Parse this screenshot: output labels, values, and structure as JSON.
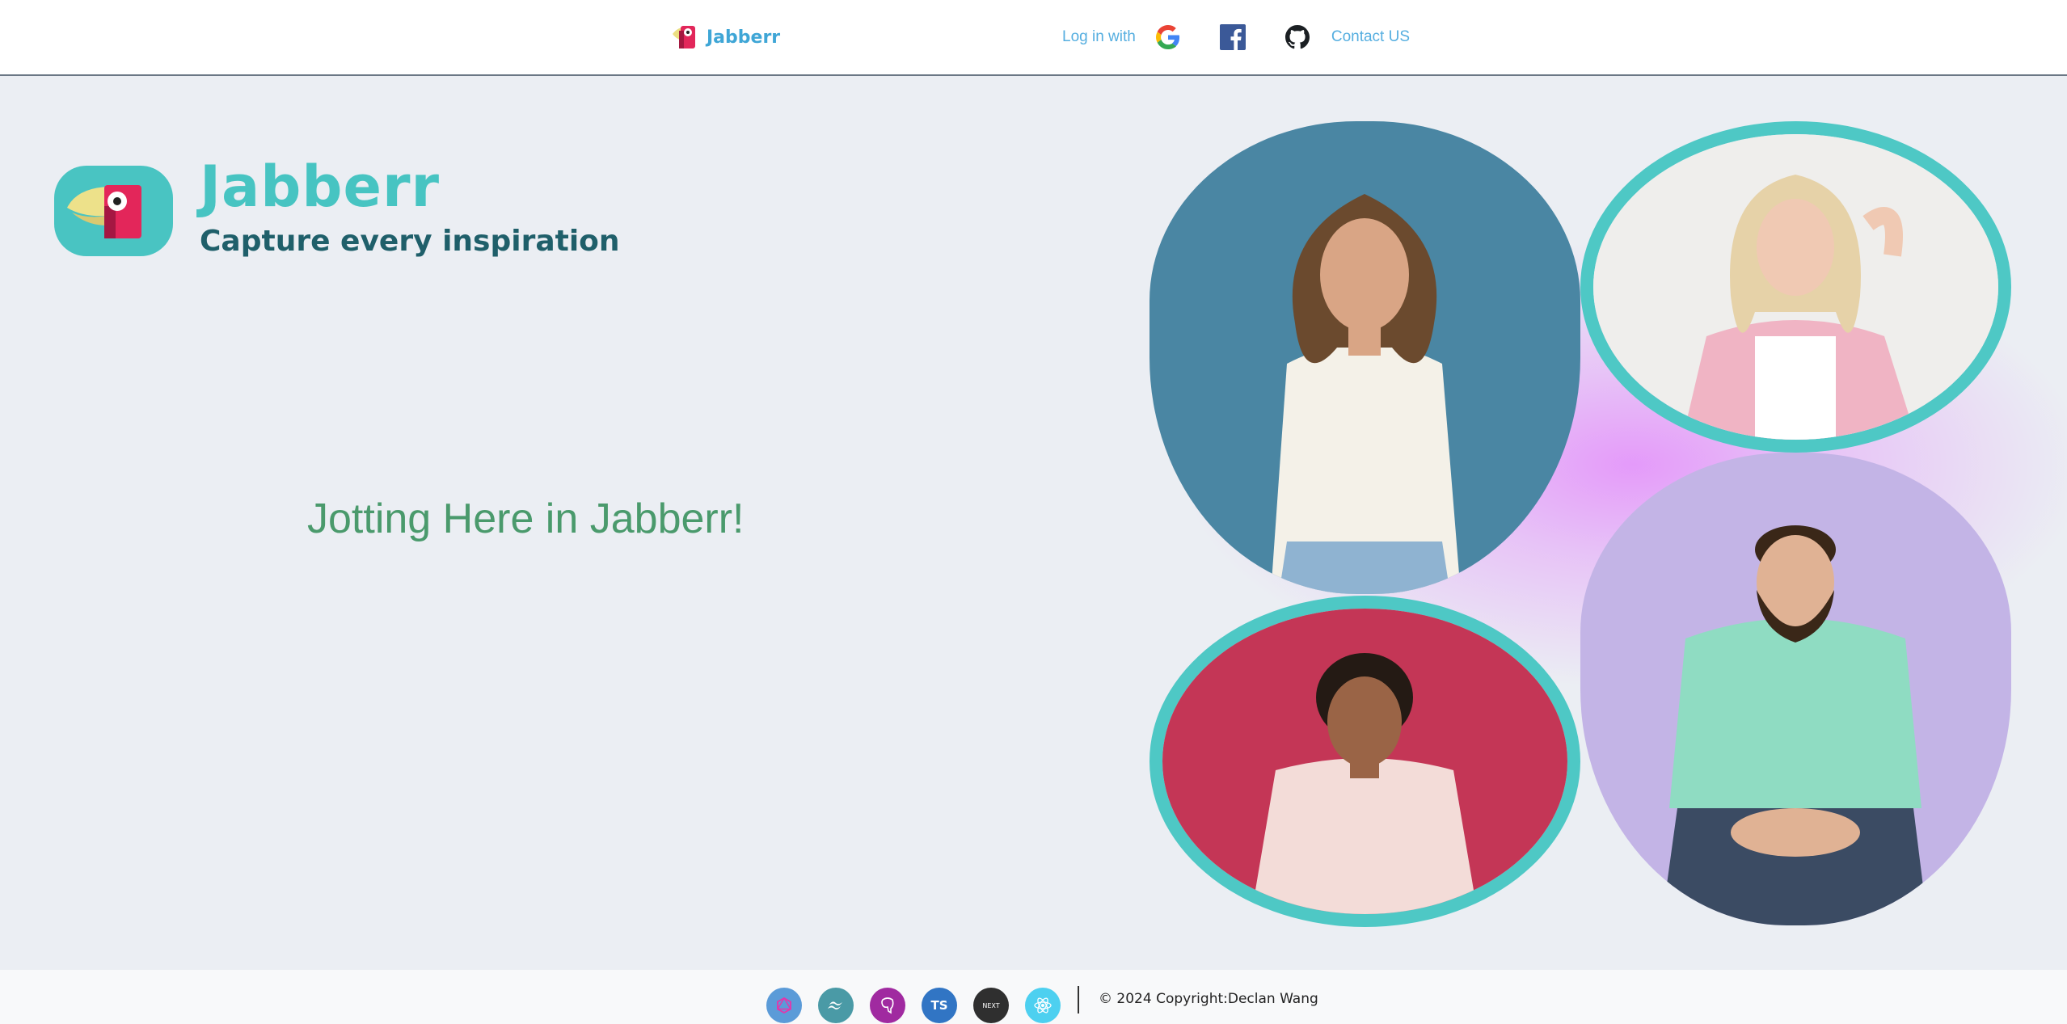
{
  "navbar": {
    "brand_name": "Jabberr",
    "login_label": "Log in with",
    "contact_label": "Contact US"
  },
  "hero": {
    "title": "Jabberr",
    "subtitle": "Capture every inspiration",
    "tagline": "Jotting Here in Jabberr!"
  },
  "photos": [
    {
      "name": "woman-white-top-photo",
      "background": "#4a86a3"
    },
    {
      "name": "woman-pink-blazer-photo",
      "background": "#efeeec"
    },
    {
      "name": "woman-pink-shirt-photo",
      "background": "#c43656"
    },
    {
      "name": "man-mint-shirt-photo",
      "background": "#c3b4e6"
    }
  ],
  "footer": {
    "tech_icons": [
      {
        "name": "graphql-icon",
        "color": "#5b9bd8"
      },
      {
        "name": "tailwind-icon",
        "color": "#4a9aa6"
      },
      {
        "name": "postgres-icon",
        "color": "#a02aa0"
      },
      {
        "name": "typescript-icon",
        "label": "TS",
        "color": "#3175c4"
      },
      {
        "name": "nextjs-icon",
        "label": "NEXT",
        "color": "#2f2f2f"
      },
      {
        "name": "react-icon",
        "color": "#4dd0f0"
      }
    ],
    "copyright": "© 2024 Copyright:Declan Wang"
  },
  "colors": {
    "accent_teal": "#47c4c2",
    "dark_teal": "#1f5f6a",
    "link_blue": "#55aee0",
    "tagline_green": "#4a9a6c",
    "page_bg": "#ebeef3"
  }
}
